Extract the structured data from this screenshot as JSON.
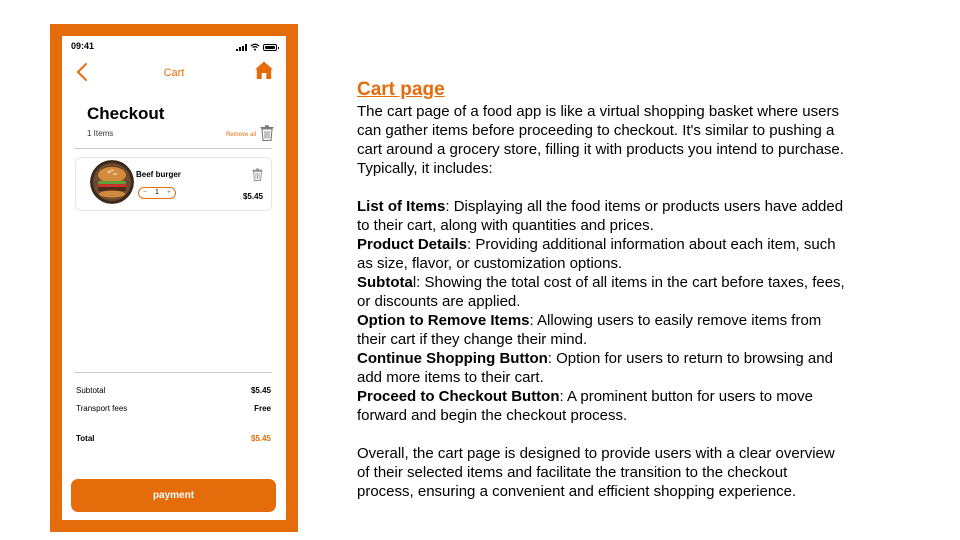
{
  "phone": {
    "status_time": "09:41",
    "nav_title": "Cart",
    "checkout_title": "Checkout",
    "items_count": "1 Items",
    "remove_all": "Remove all",
    "item": {
      "name": "Beef burger",
      "quantity": "1",
      "minus": "−",
      "plus": "+",
      "price": "$5.45"
    },
    "summary": {
      "subtotal_label": "Subtotal",
      "subtotal_value": "$5.45",
      "transport_label": "Transport fees",
      "transport_value": "Free",
      "total_label": "Total",
      "total_value": "$5.45"
    },
    "payment_label": "payment",
    "icons": [
      "back-arrow-icon",
      "home-icon",
      "trash-icon",
      "signal-icon",
      "wifi-icon",
      "battery-icon"
    ]
  },
  "panel": {
    "title": "Cart page",
    "intro": "The cart page of a food app is like a virtual shopping basket where users can gather items before proceeding to checkout. It's similar to pushing a cart around a grocery store, filling it with products you intend to purchase. Typically, it includes:",
    "features": [
      {
        "term": "List of Items",
        "desc": ": Displaying all the food items or products users have added to their cart, along with quantities and prices."
      },
      {
        "term": "Product Details",
        "desc": ": Providing additional information about each item, such as size, flavor, or customization options."
      },
      {
        "term": "Subtota",
        "desc": "l: Showing the total cost of all items in the cart before taxes, fees, or discounts are applied."
      },
      {
        "term": "Option to Remove Items",
        "desc": ": Allowing users to easily remove items from their cart if they change their mind."
      },
      {
        "term": "Continue Shopping Button",
        "desc": ": Option for users to return to browsing and add more items to their cart."
      },
      {
        "term": "Proceed to Checkout Button",
        "desc": ": A prominent button for users to move forward and begin the checkout process."
      }
    ],
    "conclusion": "Overall, the cart page is designed to provide users with a clear overview of their selected items and facilitate the transition to the checkout process, ensuring a convenient and efficient shopping experience."
  },
  "colors": {
    "accent": "#e46c0a",
    "text": "#000000",
    "background": "#ffffff"
  }
}
